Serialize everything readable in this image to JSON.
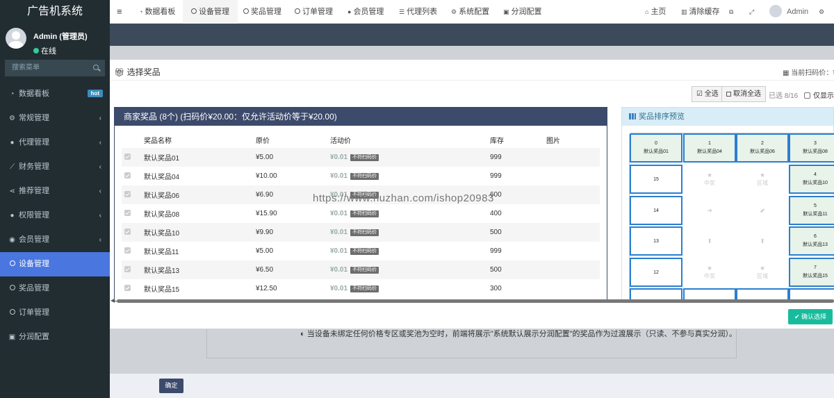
{
  "app": {
    "title": "广告机系统"
  },
  "user": {
    "name": "Admin (管理员)",
    "status": "在线"
  },
  "search": {
    "placeholder": "搜索菜单"
  },
  "sidebar": {
    "items": [
      {
        "label": "数据看板",
        "icon": "dashboard-icon",
        "badge": "hot"
      },
      {
        "label": "常规管理",
        "icon": "gears-icon"
      },
      {
        "label": "代理管理",
        "icon": "users-icon"
      },
      {
        "label": "财务管理",
        "icon": "line-chart-icon"
      },
      {
        "label": "推荐管理",
        "icon": "share-icon"
      },
      {
        "label": "权限管理",
        "icon": "group-icon"
      },
      {
        "label": "会员管理",
        "icon": "user-circle-icon"
      },
      {
        "label": "设备管理",
        "icon": "circle-icon",
        "active": true
      },
      {
        "label": "奖品管理",
        "icon": "circle-icon"
      },
      {
        "label": "订单管理",
        "icon": "circle-icon"
      },
      {
        "label": "分润配置",
        "icon": "money-icon"
      }
    ]
  },
  "topbar": {
    "tabs": [
      {
        "label": "数据看板",
        "icon": "dashboard-icon"
      },
      {
        "label": "设备管理",
        "icon": "circle-icon",
        "active": true
      },
      {
        "label": "奖品管理",
        "icon": "circle-icon"
      },
      {
        "label": "订单管理",
        "icon": "circle-icon"
      },
      {
        "label": "会员管理",
        "icon": "user-icon"
      },
      {
        "label": "代理列表",
        "icon": "list-icon"
      },
      {
        "label": "系统配置",
        "icon": "gear-icon"
      },
      {
        "label": "分润配置",
        "icon": "money-icon"
      }
    ],
    "home": "主页",
    "clear_cache": "清除缓存",
    "admin": "Admin"
  },
  "modal": {
    "title": "选择奖品",
    "current_price_label": "当前扫码价：",
    "current_price_value": "¥",
    "select_all": "全选",
    "deselect_all": "取消全选",
    "selected_count": "已选 8/16",
    "only_show": "仅显示",
    "left_panel_title": "商家奖品 (8个) (扫码价¥20.00：仅允许活动价等于¥20.00)",
    "columns": [
      "奖品名称",
      "原价",
      "活动价",
      "库存",
      "图片"
    ],
    "tag_text": "不符扫码价",
    "rows": [
      {
        "name": "默认奖品01",
        "price": "¥5.00",
        "act": "¥0.01",
        "stock": "999"
      },
      {
        "name": "默认奖品04",
        "price": "¥10.00",
        "act": "¥0.01",
        "stock": "999"
      },
      {
        "name": "默认奖品06",
        "price": "¥6.90",
        "act": "¥0.01",
        "stock": "600"
      },
      {
        "name": "默认奖品08",
        "price": "¥15.90",
        "act": "¥0.01",
        "stock": "400"
      },
      {
        "name": "默认奖品10",
        "price": "¥9.90",
        "act": "¥0.01",
        "stock": "500"
      },
      {
        "name": "默认奖品11",
        "price": "¥5.00",
        "act": "¥0.01",
        "stock": "999"
      },
      {
        "name": "默认奖品13",
        "price": "¥6.50",
        "act": "¥0.01",
        "stock": "500"
      },
      {
        "name": "默认奖品15",
        "price": "¥12.50",
        "act": "¥0.01",
        "stock": "300"
      }
    ],
    "right_panel_title": "奖品排序预览",
    "grid": {
      "top": [
        {
          "n": "0",
          "name": "默认奖品01"
        },
        {
          "n": "1",
          "name": "默认奖品04"
        },
        {
          "n": "2",
          "name": "默认奖品06"
        },
        {
          "n": "3",
          "name": "默认奖品08"
        }
      ],
      "right": [
        {
          "n": "4",
          "name": "默认奖品10"
        },
        {
          "n": "5",
          "name": "默认奖品11"
        },
        {
          "n": "6",
          "name": "默认奖品13"
        },
        {
          "n": "7",
          "name": "默认奖品15"
        }
      ],
      "left": [
        "15",
        "14",
        "13",
        "12"
      ],
      "center_prize": "中奖",
      "center_zone": "区域"
    },
    "confirm_select": "确认选择"
  },
  "background": {
    "note": "当设备未绑定任何价格专区或奖池为空时，前端将展示\"系统默认展示分润配置\"的奖品作为过渡展示（只读、不参与真实分润）。",
    "confirm": "确定"
  },
  "watermark": "https://www.huzhan.com/ishop20983",
  "colors": {
    "sidebar_bg": "#222d32",
    "active": "#4a76e0",
    "header": "#3c4a6b",
    "success": "#18bc9c"
  }
}
